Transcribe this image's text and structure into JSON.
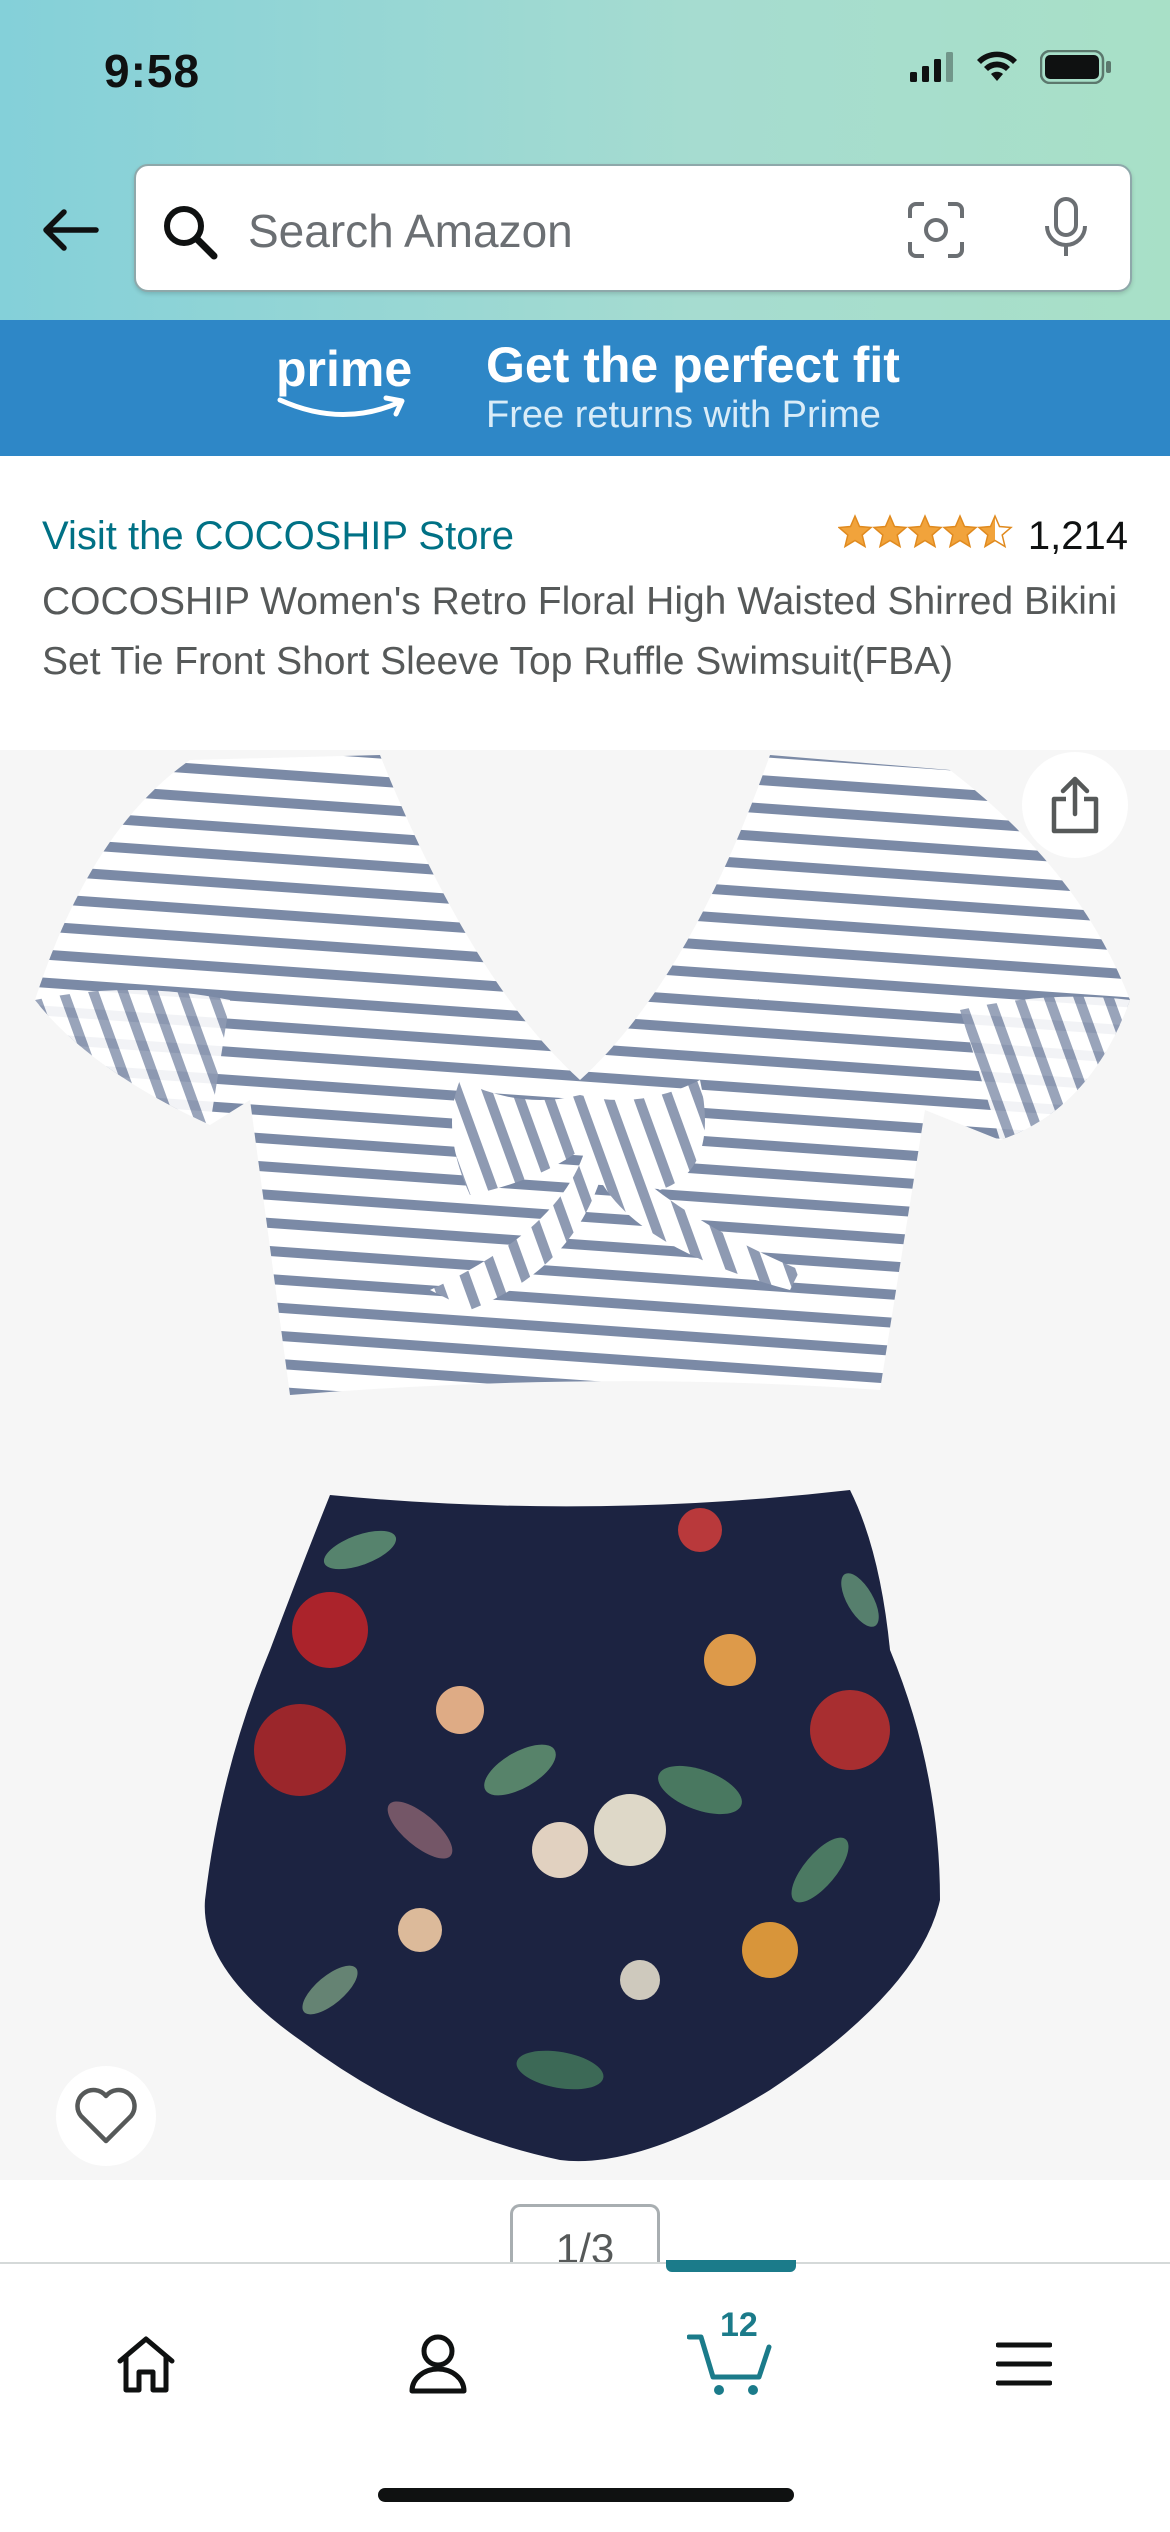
{
  "status_bar": {
    "time": "9:58",
    "icons": [
      "cellular-signal-icon",
      "wifi-icon",
      "battery-icon"
    ]
  },
  "search": {
    "placeholder": "Search Amazon",
    "icons": [
      "back-arrow-icon",
      "search-icon",
      "camera-scan-icon",
      "microphone-icon"
    ]
  },
  "prime_banner": {
    "logo_text": "prime",
    "title": "Get the perfect fit",
    "subtitle": "Free returns with Prime"
  },
  "product": {
    "store_link": "Visit the COCOSHIP Store",
    "rating": 4.5,
    "rating_count": "1,214",
    "title": "COCOSHIP Women's Retro Floral High Waisted Shirred Bikini Set Tie Front Short Sleeve Top Ruffle Swimsuit(FBA)",
    "image_pager": "1/3"
  },
  "bottom_nav": {
    "items": [
      "home-icon",
      "account-icon",
      "cart-icon",
      "menu-icon"
    ],
    "cart_count": "12"
  },
  "colors": {
    "header_gradient_start": "#84d0d9",
    "header_gradient_end": "#a8e0c7",
    "prime_blue": "#2e87c7",
    "link_teal": "#007185",
    "star_orange": "#f1a33b",
    "cart_teal": "#1b7b8a"
  }
}
